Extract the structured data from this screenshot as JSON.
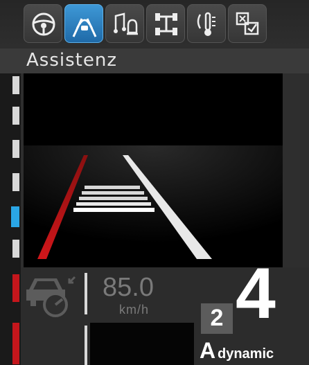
{
  "menu": {
    "icons": [
      {
        "name": "steering-wheel-icon",
        "active": false
      },
      {
        "name": "driver-assist-icon",
        "active": true
      },
      {
        "name": "audio-alert-icon",
        "active": false
      },
      {
        "name": "chassis-icon",
        "active": false
      },
      {
        "name": "temperature-icon",
        "active": false
      },
      {
        "name": "settings-icon",
        "active": false
      }
    ],
    "accent_color": "#2a8fd6"
  },
  "section_title": "Assistenz",
  "cruise": {
    "speed": "85.0",
    "unit": "km/h",
    "icon": "cruise-control-icon"
  },
  "transmission": {
    "small_gear": "2",
    "gear": "4",
    "mode_letter": "A",
    "mode_name": "dynamic"
  },
  "colors": {
    "lane_left": "#d0161a",
    "lane_right": "#ffffff",
    "active_tab": "#2a8fd6"
  }
}
